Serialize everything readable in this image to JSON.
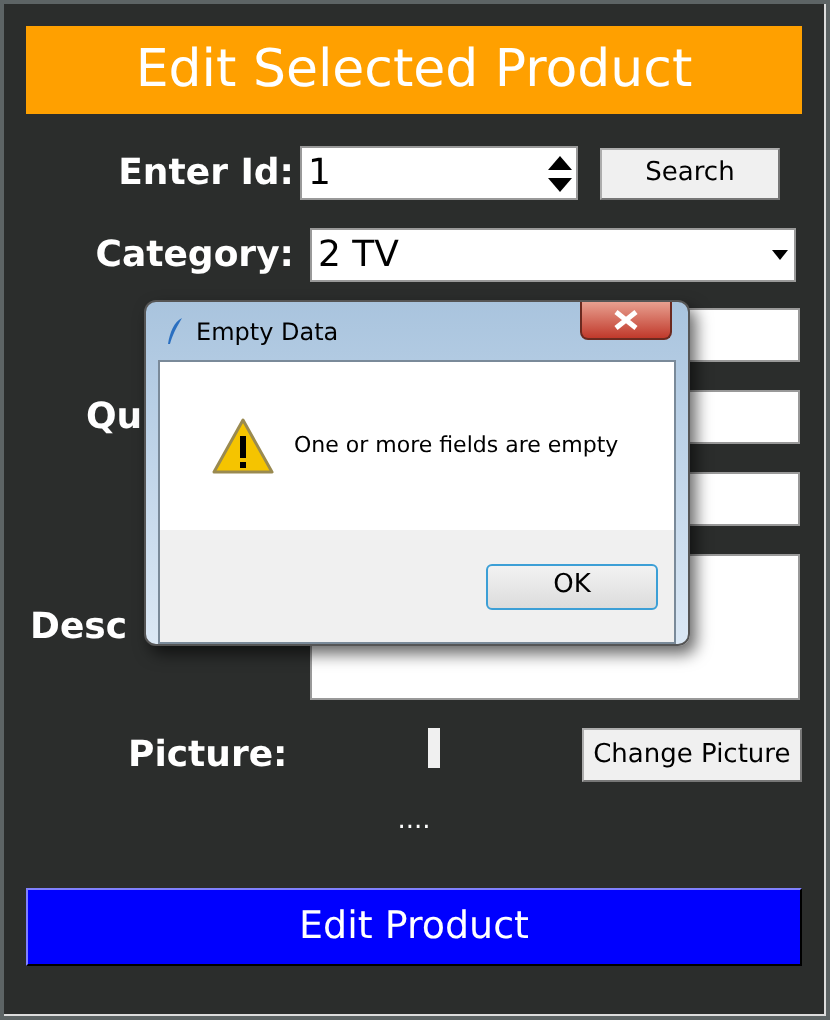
{
  "title": "Edit Selected Product",
  "id_field": {
    "label": "Enter Id:",
    "value": "1"
  },
  "search_button": "Search",
  "category": {
    "label": "Category:",
    "value": "2 TV"
  },
  "fields": [
    {
      "kind": "entry"
    },
    {
      "kind": "entry",
      "label": "Qu"
    },
    {
      "kind": "entry"
    },
    {
      "kind": "text",
      "label": "Desc"
    }
  ],
  "picture": {
    "label": "Picture:",
    "button": "Change Picture",
    "caption": "...."
  },
  "submit_button": "Edit Product",
  "dialog": {
    "title": "Empty Data",
    "message": "One or more fields are empty",
    "button": "OK"
  }
}
